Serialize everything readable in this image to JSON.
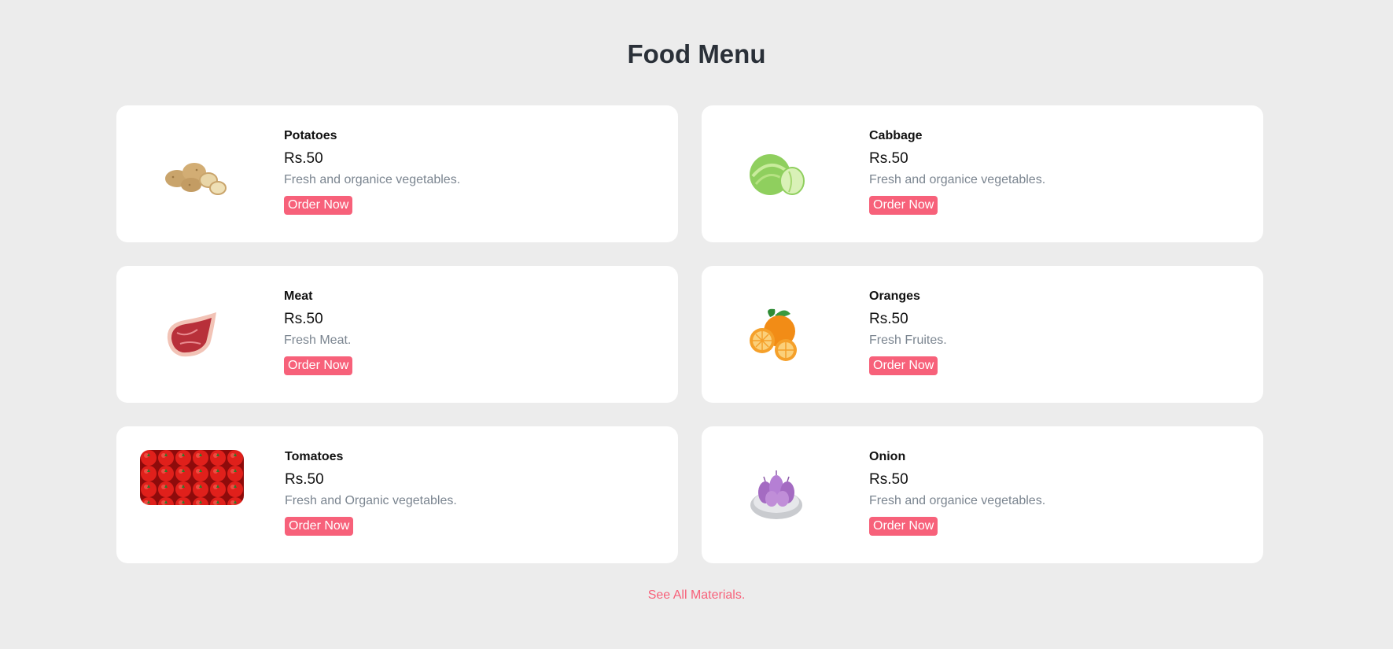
{
  "header": {
    "title": "Food Menu"
  },
  "items": [
    {
      "name": "Potatoes",
      "price": "Rs.50",
      "desc": "Fresh and organice vegetables.",
      "button": "Order Now",
      "image": "potatoes-image"
    },
    {
      "name": "Cabbage",
      "price": "Rs.50",
      "desc": "Fresh and organice vegetables.",
      "button": "Order Now",
      "image": "cabbage-image"
    },
    {
      "name": "Meat",
      "price": "Rs.50",
      "desc": "Fresh Meat.",
      "button": "Order Now",
      "image": "meat-image"
    },
    {
      "name": "Oranges",
      "price": "Rs.50",
      "desc": "Fresh Fruites.",
      "button": "Order Now",
      "image": "oranges-image"
    },
    {
      "name": "Tomatoes",
      "price": "Rs.50",
      "desc": "Fresh and Organic vegetables.",
      "button": "Order Now",
      "image": "tomatoes-image"
    },
    {
      "name": "Onion",
      "price": "Rs.50",
      "desc": "Fresh and organice vegetables.",
      "button": "Order Now",
      "image": "onion-image"
    }
  ],
  "footer": {
    "link": "See All Materials."
  },
  "colors": {
    "accent": "#f7617a",
    "background": "#ececec",
    "title": "#2a3038",
    "muted": "#7b8590"
  }
}
